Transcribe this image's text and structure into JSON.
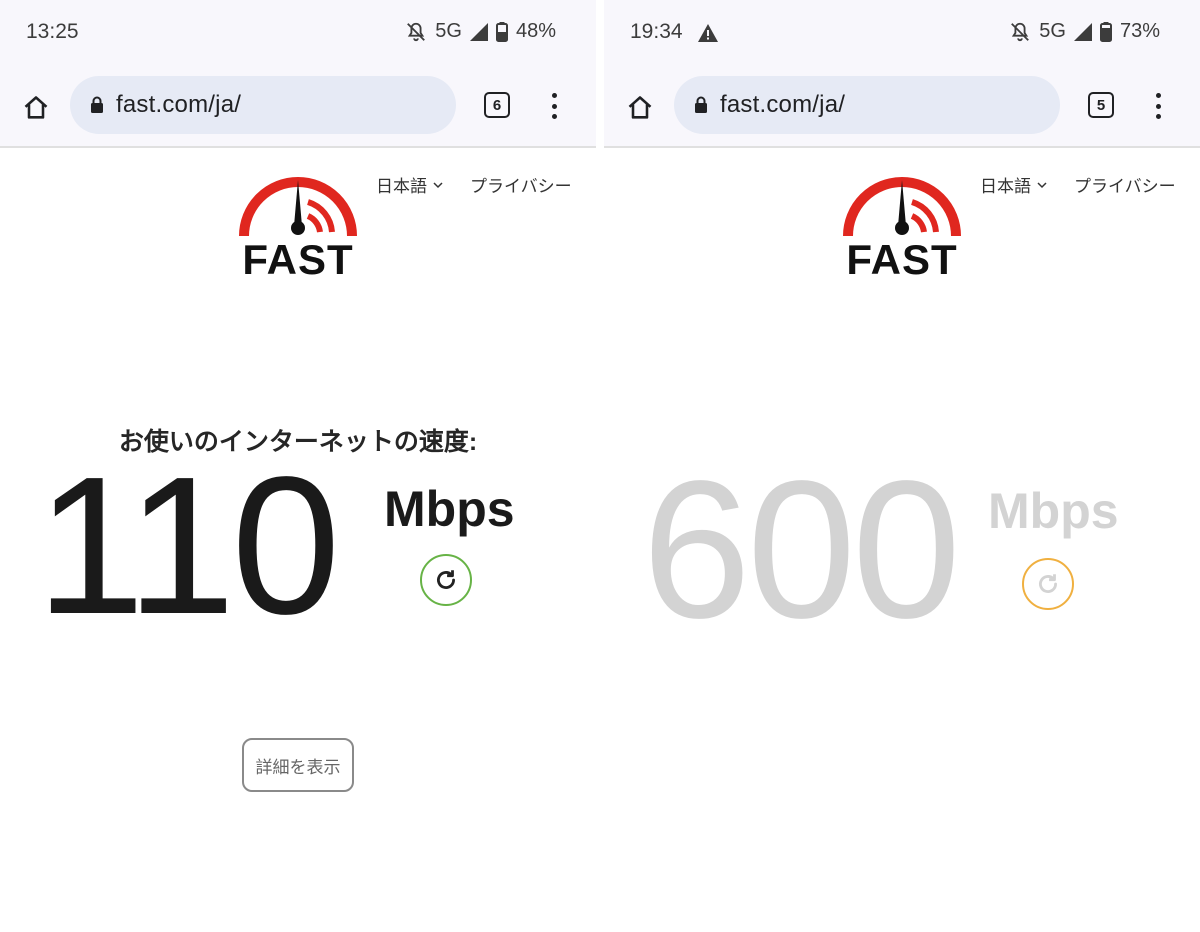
{
  "colors": {
    "logo_red": "#e0271f",
    "reload_ring_done": "#67b346",
    "reload_ring_testing": "#f0b040",
    "testing_text": "#d3d3d3"
  },
  "left": {
    "status": {
      "time": "13:25",
      "network": "5G",
      "battery": "48%"
    },
    "browser": {
      "url": "fast.com/ja/",
      "tab_count": "6"
    },
    "page": {
      "language": "日本語",
      "privacy": "プライバシー",
      "logo_text": "FAST",
      "heading": "お使いのインターネットの速度:",
      "speed_value": "110",
      "speed_unit": "Mbps",
      "details_button": "詳細を表示"
    }
  },
  "right": {
    "status": {
      "time": "19:34",
      "network": "5G",
      "battery": "73%"
    },
    "browser": {
      "url": "fast.com/ja/",
      "tab_count": "5"
    },
    "page": {
      "language": "日本語",
      "privacy": "プライバシー",
      "logo_text": "FAST",
      "speed_value": "600",
      "speed_unit": "Mbps"
    }
  }
}
